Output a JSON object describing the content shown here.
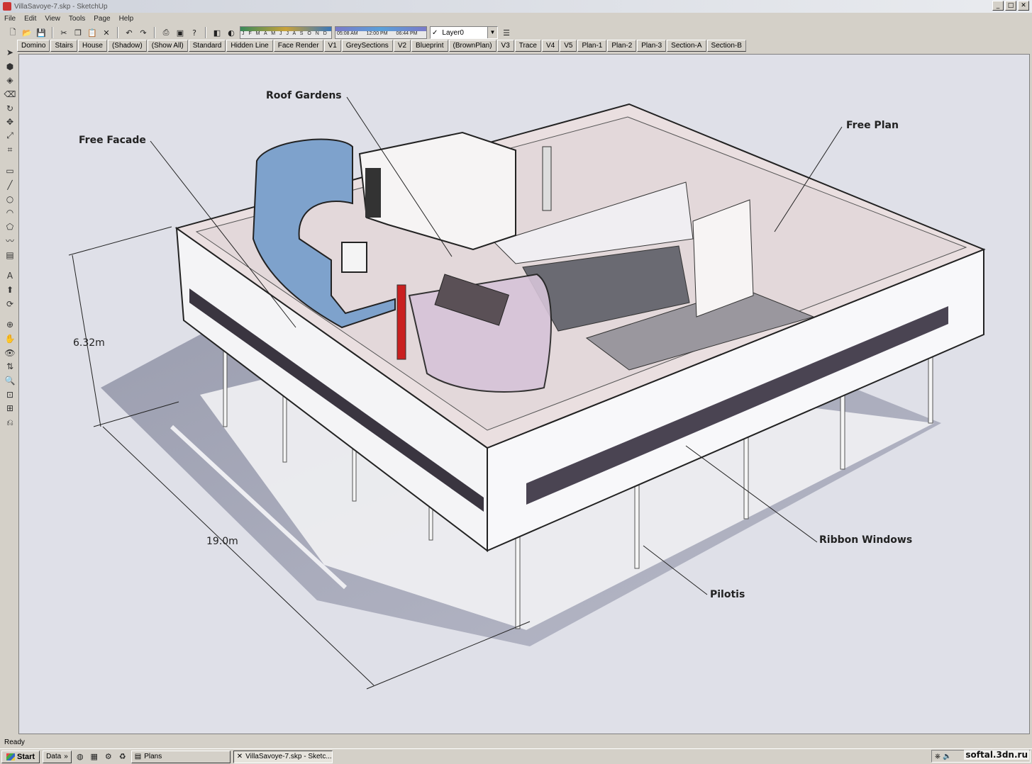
{
  "window": {
    "title": "VillaSavoye-7.skp - SketchUp",
    "buttons": [
      "_",
      "□",
      "✕"
    ]
  },
  "menu": [
    "File",
    "Edit",
    "View",
    "Tools",
    "Page",
    "Help"
  ],
  "toolbar": {
    "months": "J F M A M J J A S O N D",
    "times": [
      "05:08 AM",
      "12:00 PM",
      "06:44 PM"
    ],
    "layer": "Layer0"
  },
  "pages": [
    "Domino",
    "Stairs",
    "House",
    "(Shadow)",
    "(Show All)",
    "Standard",
    "Hidden Line",
    "Face Render",
    "V1",
    "GreySections",
    "V2",
    "Blueprint",
    "(BrownPlan)",
    "V3",
    "Trace",
    "V4",
    "V5",
    "Plan-1",
    "Plan-2",
    "Plan-3",
    "Section-A",
    "Section-B"
  ],
  "callouts": {
    "roof_gardens": "Roof Gardens",
    "free_facade": "Free Facade",
    "free_plan": "Free Plan",
    "ribbon_windows": "Ribbon Windows",
    "pilotis": "Pilotis"
  },
  "dimensions": {
    "height": "6.32m",
    "length": "19.0m"
  },
  "status": "Ready",
  "taskbar": {
    "start": "Start",
    "group": "Data",
    "tasks": [
      "Plans",
      "VillaSavoye-7.skp - Sketc..."
    ]
  },
  "watermark": "softal.3dn.ru"
}
